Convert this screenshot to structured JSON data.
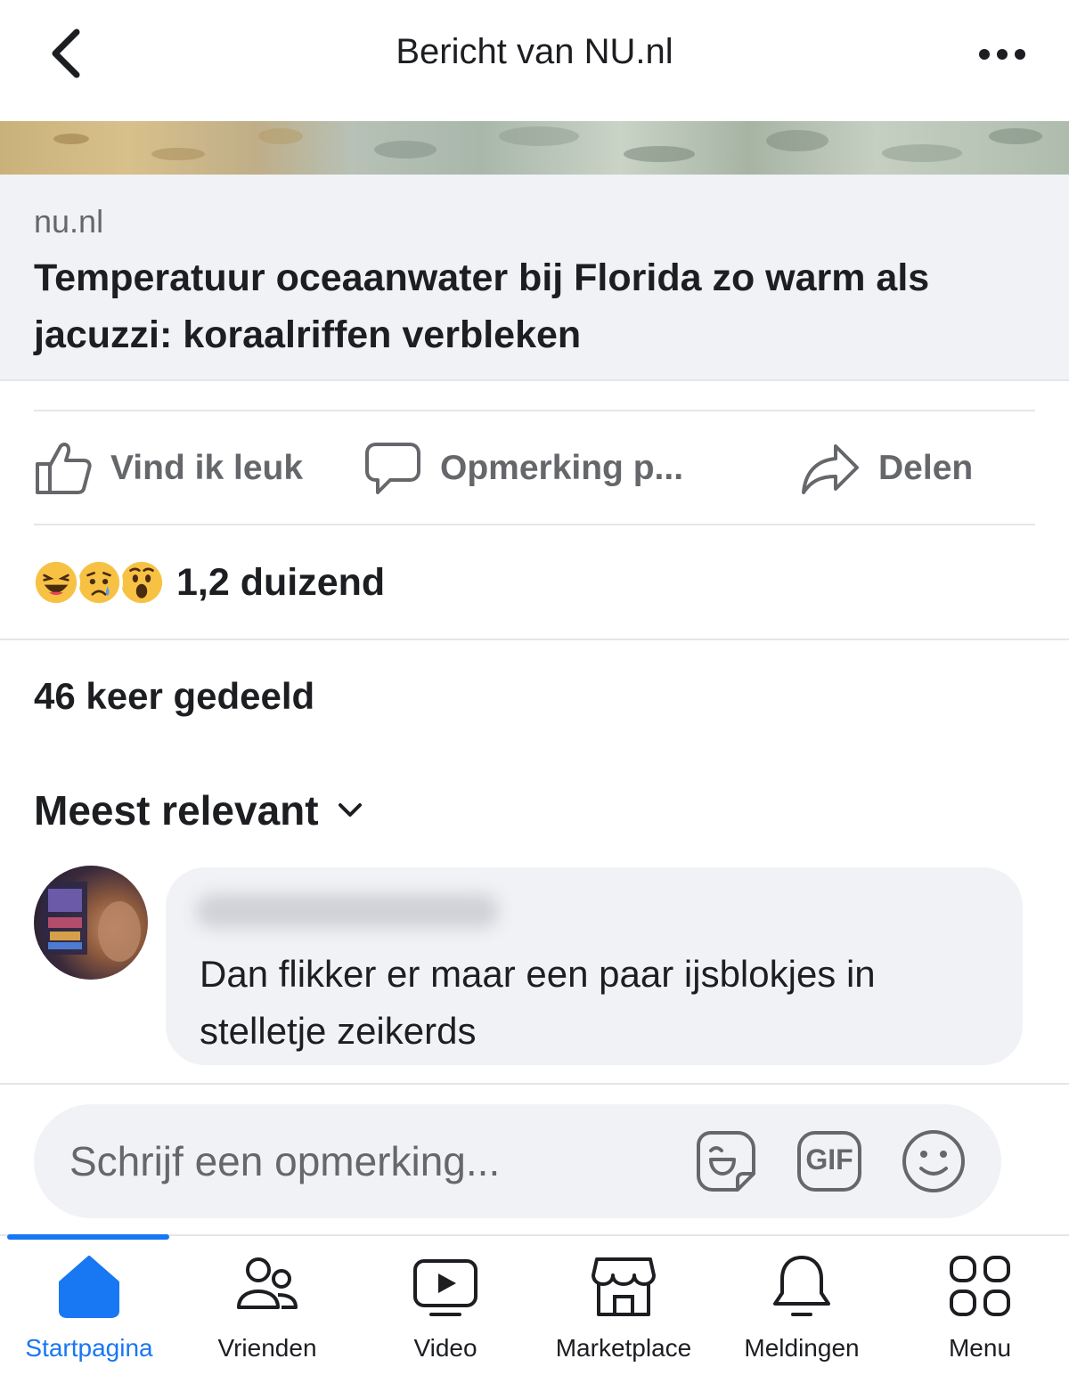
{
  "header": {
    "title": "Bericht van NU.nl"
  },
  "link_preview": {
    "domain": "nu.nl",
    "title": "Temperatuur oceaanwater bij Florida zo warm als jacuzzi: koraalriffen verbleken"
  },
  "actions": {
    "like_label": "Vind ik leuk",
    "comment_label": "Opmerking p...",
    "share_label": "Delen"
  },
  "reactions": {
    "icons": [
      "haha-emoji-icon",
      "sad-emoji-icon",
      "wow-emoji-icon"
    ],
    "count": "1,2 duizend"
  },
  "shares": {
    "text": "46 keer gedeeld"
  },
  "comments": {
    "sort_label": "Meest relevant",
    "items": [
      {
        "text": "Dan flikker er maar een paar ijsblokjes in stelletje zeikerds"
      }
    ]
  },
  "comment_input": {
    "placeholder": "Schrijf een opmerking...",
    "gif_label": "GIF"
  },
  "bottom_nav": {
    "items": [
      {
        "label": "Startpagina",
        "icon": "home-icon",
        "active": true
      },
      {
        "label": "Vrienden",
        "icon": "friends-icon",
        "active": false
      },
      {
        "label": "Video",
        "icon": "video-icon",
        "active": false
      },
      {
        "label": "Marketplace",
        "icon": "marketplace-icon",
        "active": false
      },
      {
        "label": "Meldingen",
        "icon": "bell-icon",
        "active": false
      },
      {
        "label": "Menu",
        "icon": "menu-grid-icon",
        "active": false
      }
    ]
  },
  "colors": {
    "accent": "#1877f2",
    "secondary_text": "#65676b",
    "surface": "#f0f2f5"
  }
}
